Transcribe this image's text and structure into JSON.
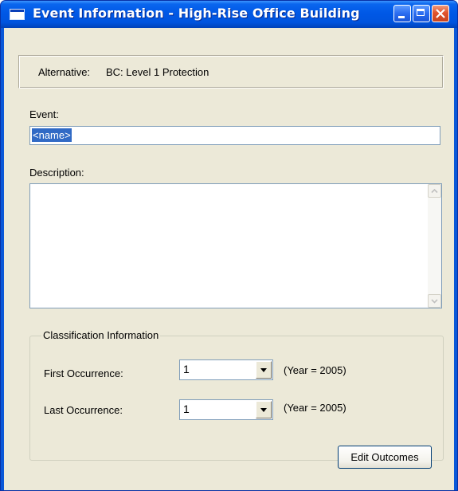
{
  "window": {
    "title": "Event Information - High-Rise Office Building"
  },
  "alternative": {
    "label": "Alternative:",
    "value": "BC: Level 1 Protection"
  },
  "event": {
    "label": "Event:",
    "value": "<name>"
  },
  "description": {
    "label": "Description:",
    "value": ""
  },
  "classification": {
    "title": "Classification Information",
    "first": {
      "label": "First Occurrence:",
      "value": "1",
      "note": "(Year = 2005)"
    },
    "last": {
      "label": "Last Occurrence:",
      "value": "1",
      "note": "(Year = 2005)"
    }
  },
  "actions": {
    "edit_outcomes": "Edit Outcomes"
  },
  "icons": {
    "app": "window-app-icon",
    "minimize": "minimize-icon",
    "maximize": "maximize-icon",
    "close": "close-icon",
    "scroll_up": "scroll-up-arrow-icon",
    "scroll_down": "scroll-down-arrow-icon",
    "dropdown": "dropdown-arrow-icon"
  },
  "colors": {
    "titlebar": "#0058E6",
    "client_background": "#ECE9D8",
    "selection": "#316AC5",
    "close_button": "#E1542D"
  }
}
